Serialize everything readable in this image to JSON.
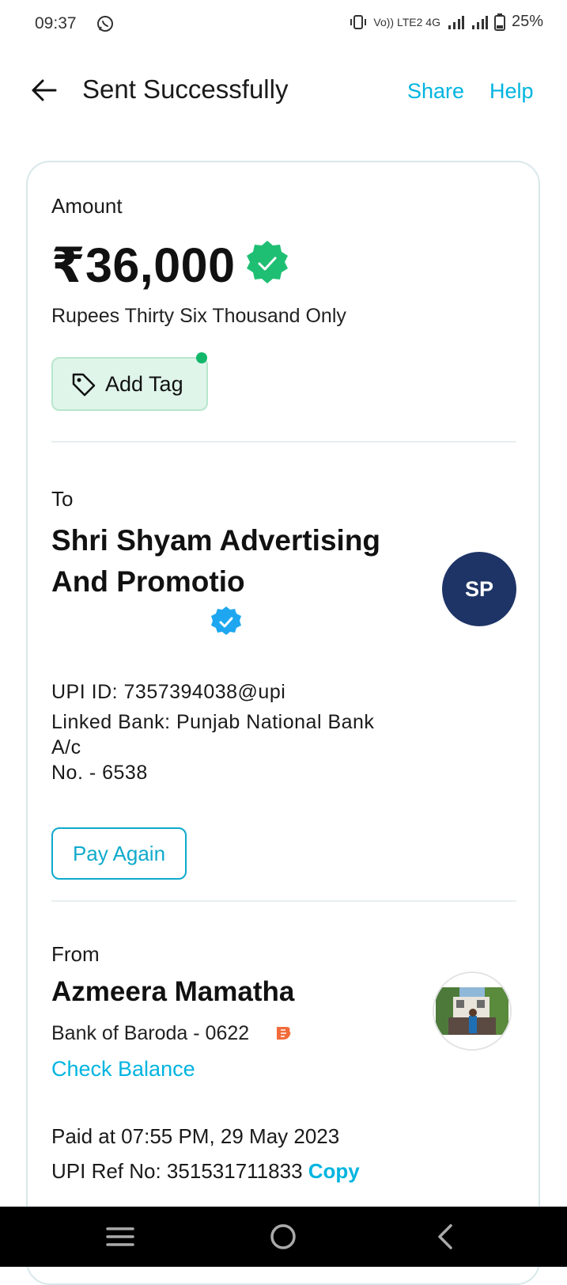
{
  "status_bar": {
    "time": "09:37",
    "network_info": "Vo)) LTE2 4G",
    "battery": "25%"
  },
  "header": {
    "title": "Sent Successfully",
    "share_label": "Share",
    "help_label": "Help"
  },
  "amount_section": {
    "label": "Amount",
    "amount": "₹36,000",
    "amount_in_words": "Rupees Thirty Six Thousand Only",
    "add_tag_label": "Add Tag"
  },
  "to_section": {
    "label": "To",
    "payee_name": "Shri Shyam Advertising And Promotio",
    "avatar_initials": "SP",
    "upi_id": "UPI ID: 7357394038@upi",
    "linked_bank_line1": "Linked Bank: Punjab National Bank",
    "linked_bank_line2": "A/c",
    "linked_bank_line3": "No. - 6538",
    "pay_again_label": "Pay Again"
  },
  "from_section": {
    "label": "From",
    "payer_name": "Azmeera Mamatha",
    "bank": "Bank of Baroda - 0622",
    "check_balance_label": "Check Balance"
  },
  "transaction": {
    "paid_at": "Paid at 07:55 PM, 29 May 2023",
    "upi_ref": "UPI Ref No: 351531711833",
    "copy_label": "Copy"
  },
  "colors": {
    "accent": "#00b4e0",
    "success_green": "#12b76a",
    "avatar_bg": "#1e3466"
  },
  "icons": {
    "back": "arrow-left-icon",
    "verified_green": "verified-badge-icon",
    "verified_blue": "verified-badge-icon",
    "tag": "tag-icon",
    "bank_logo": "bank-of-baroda-icon"
  }
}
